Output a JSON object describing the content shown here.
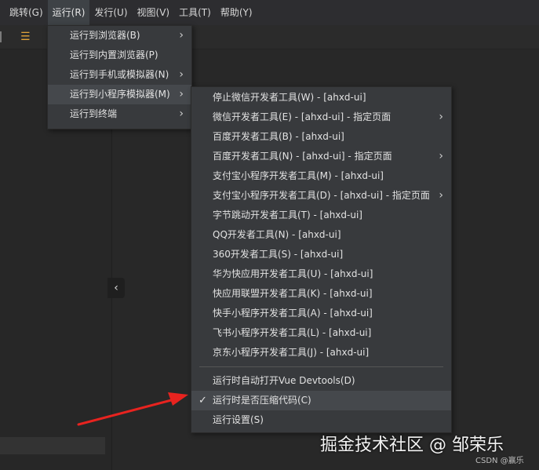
{
  "menubar": {
    "items": [
      {
        "label": "跳转(G)"
      },
      {
        "label": "运行(R)"
      },
      {
        "label": "发行(U)"
      },
      {
        "label": "视图(V)"
      },
      {
        "label": "工具(T)"
      },
      {
        "label": "帮助(Y)"
      }
    ]
  },
  "run_menu": {
    "items": [
      {
        "label": "运行到浏览器(B)",
        "submenu": true
      },
      {
        "label": "运行到内置浏览器(P)",
        "submenu": false
      },
      {
        "label": "运行到手机或模拟器(N)",
        "submenu": true
      },
      {
        "label": "运行到小程序模拟器(M)",
        "submenu": true
      },
      {
        "label": "运行到终端",
        "submenu": true
      }
    ]
  },
  "miniprogram_menu": {
    "items": [
      {
        "label": "停止微信开发者工具(W) - [ahxd-ui]"
      },
      {
        "label": "微信开发者工具(E) - [ahxd-ui] - 指定页面"
      },
      {
        "label": "百度开发者工具(B) - [ahxd-ui]"
      },
      {
        "label": "百度开发者工具(N) - [ahxd-ui] - 指定页面"
      },
      {
        "label": "支付宝小程序开发者工具(M) - [ahxd-ui]"
      },
      {
        "label": "支付宝小程序开发者工具(D) - [ahxd-ui] - 指定页面"
      },
      {
        "label": "字节跳动开发者工具(T) - [ahxd-ui]"
      },
      {
        "label": "QQ开发者工具(N) - [ahxd-ui]"
      },
      {
        "label": "360开发者工具(S) - [ahxd-ui]"
      },
      {
        "label": "华为快应用开发者工具(U) - [ahxd-ui]"
      },
      {
        "label": "快应用联盟开发者工具(K) - [ahxd-ui]"
      },
      {
        "label": "快手小程序开发者工具(A) - [ahxd-ui]"
      },
      {
        "label": "飞书小程序开发者工具(L) - [ahxd-ui]"
      },
      {
        "label": "京东小程序开发者工具(J) - [ahxd-ui]"
      }
    ],
    "vue_devtools_label": "运行时自动打开Vue Devtools(D)",
    "compress_label": "运行时是否压缩代码(C)",
    "compress_checkmark": "✓",
    "settings_label": "运行设置(S)"
  },
  "arrow_color": "#e8231f",
  "watermark": {
    "main": "掘金技术社区 @ 邹荣乐",
    "csdn": "CSDN @赢乐"
  }
}
